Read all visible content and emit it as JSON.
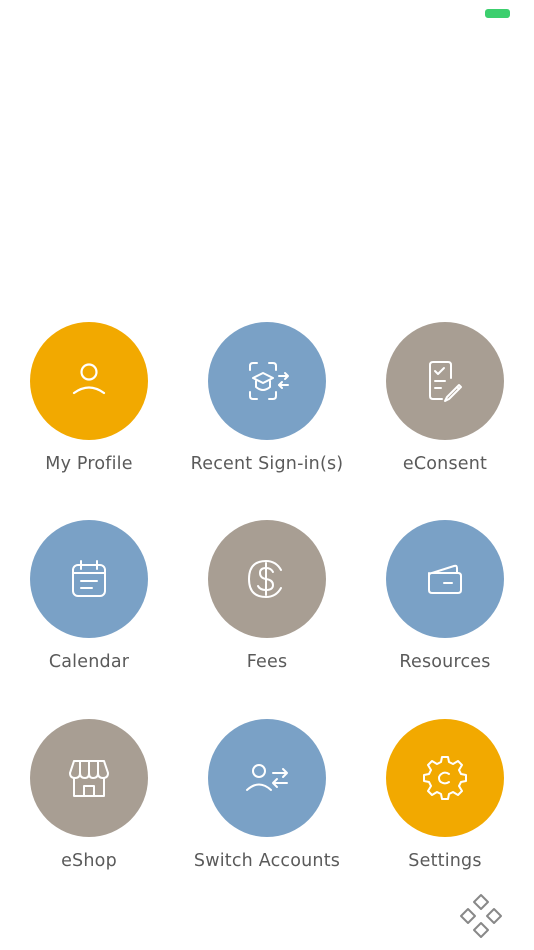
{
  "status_bar": {
    "battery_color": "#3ccf6e"
  },
  "colors": {
    "amber": "#f2a900",
    "blue": "#7aa1c6",
    "taupe": "#a89e93",
    "label_text": "#5a5a5a"
  },
  "menu": {
    "items": [
      {
        "label": "My Profile",
        "icon": "person-icon",
        "color": "#f2a900"
      },
      {
        "label": "Recent Sign-in(s)",
        "icon": "face-scan-switch-icon",
        "color": "#7aa1c6"
      },
      {
        "label": "eConsent",
        "icon": "signed-document-icon",
        "color": "#a89e93"
      },
      {
        "label": "Calendar",
        "icon": "calendar-icon",
        "color": "#7aa1c6"
      },
      {
        "label": "Fees",
        "icon": "dollar-icon",
        "color": "#a89e93"
      },
      {
        "label": "Resources",
        "icon": "wallet-icon",
        "color": "#7aa1c6"
      },
      {
        "label": "eShop",
        "icon": "storefront-icon",
        "color": "#a89e93"
      },
      {
        "label": "Switch Accounts",
        "icon": "switch-user-icon",
        "color": "#7aa1c6"
      },
      {
        "label": "Settings",
        "icon": "gear-icon",
        "color": "#f2a900"
      }
    ]
  },
  "footer": {
    "logo_icon": "diamond-cluster-logo-icon"
  }
}
